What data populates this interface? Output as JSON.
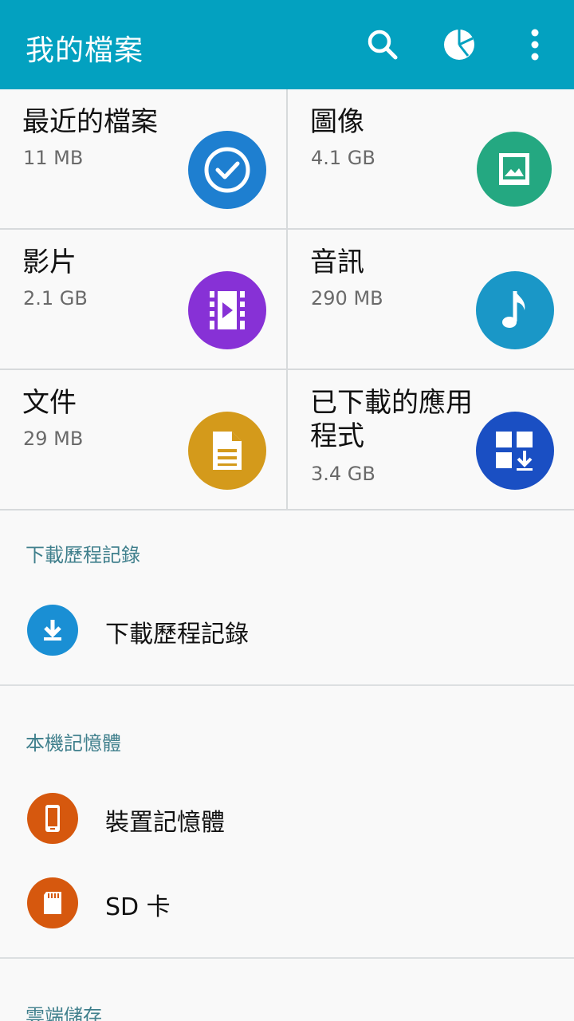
{
  "appbar": {
    "title": "我的檔案",
    "search_icon": "search-icon",
    "storage_icon": "pie-chart-icon",
    "more_icon": "more-vert-icon",
    "background": "#03a1c0"
  },
  "categories": [
    {
      "title": "最近的檔案",
      "size": "11 MB",
      "icon": "clock-check-icon",
      "color": "#1e7fd0"
    },
    {
      "title": "圖像",
      "size": "4.1 GB",
      "icon": "image-icon",
      "color": "#24a881"
    },
    {
      "title": "影片",
      "size": "2.1 GB",
      "icon": "video-icon",
      "color": "#8731d6"
    },
    {
      "title": "音訊",
      "size": "290 MB",
      "icon": "music-note-icon",
      "color": "#1a97c7"
    },
    {
      "title": "文件",
      "size": "29 MB",
      "icon": "document-icon",
      "color": "#d49a1b"
    },
    {
      "title": "已下載的應用程式",
      "size": "3.4 GB",
      "icon": "app-download-icon",
      "color": "#1a4fc3"
    }
  ],
  "sections": {
    "download_history": {
      "header": "下載歷程記錄",
      "items": [
        {
          "label": "下載歷程記錄",
          "icon": "download-icon",
          "color": "#1a8fd4"
        }
      ]
    },
    "local_storage": {
      "header": "本機記憶體",
      "items": [
        {
          "label": "裝置記憶體",
          "icon": "phone-icon",
          "color": "#d6580e"
        },
        {
          "label": "SD 卡",
          "icon": "sd-card-icon",
          "color": "#d6580e"
        }
      ]
    },
    "cloud_storage": {
      "header": "雲端儲存"
    }
  }
}
